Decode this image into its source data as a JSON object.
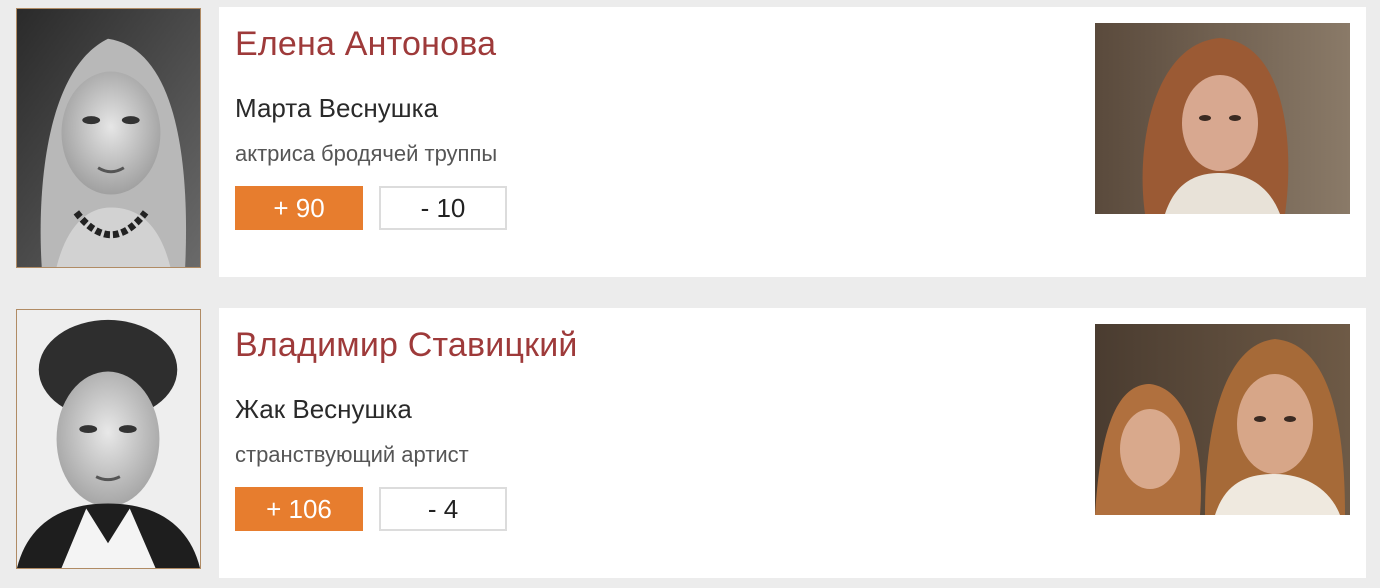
{
  "cast": [
    {
      "actor_name": "Елена Антонова",
      "role_name": "Марта Веснушка",
      "role_description": "актриса бродячей труппы",
      "votes_up": "+ 90",
      "votes_down": "- 10"
    },
    {
      "actor_name": "Владимир Ставицкий",
      "role_name": "Жак Веснушка",
      "role_description": "странствующий артист",
      "votes_up": "+ 106",
      "votes_down": "- 4"
    }
  ],
  "colors": {
    "actor_name": "#9e3a3a",
    "upvote": "#e77d2e",
    "background": "#ececec"
  }
}
